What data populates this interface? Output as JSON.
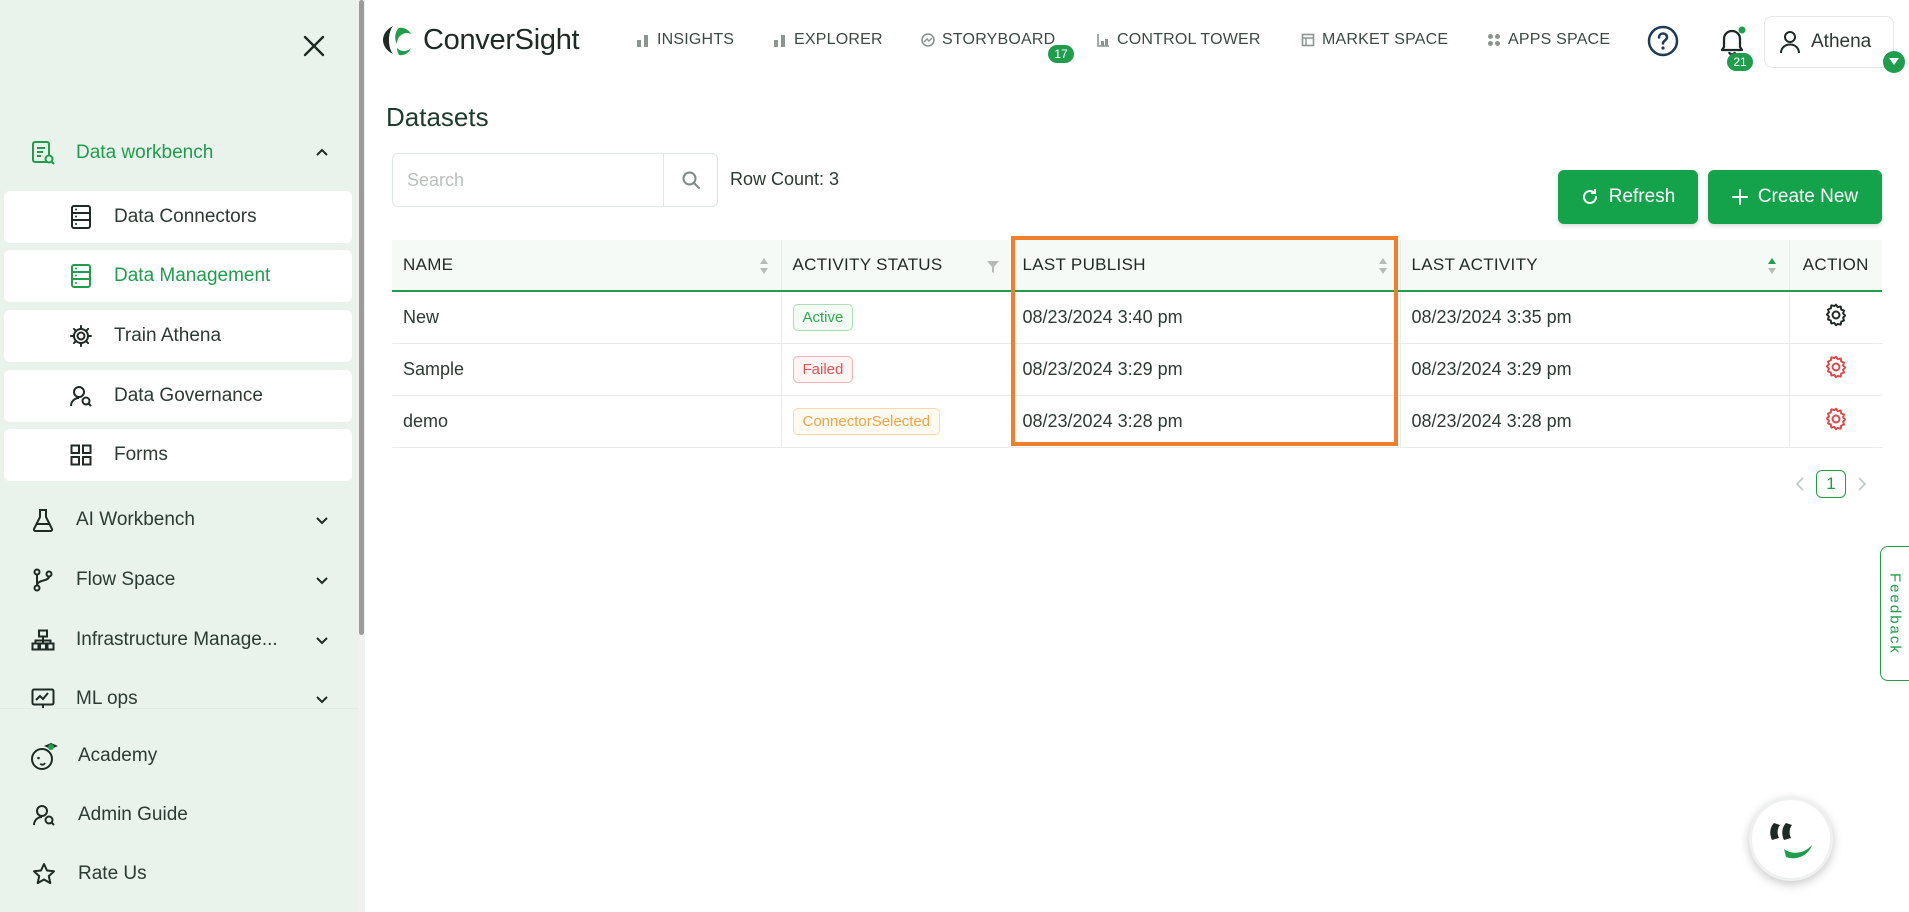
{
  "app": {
    "brand": "ConverSight",
    "accent": "#1f9d4c",
    "button_green": "#14a24a",
    "highlight": "#f07e2b"
  },
  "sidebar": {
    "close_icon": "close-icon",
    "groups": [
      {
        "label": "Data workbench",
        "icon": "data-workbench-icon",
        "expanded": true
      },
      {
        "label": "AI Workbench",
        "icon": "flask-icon"
      },
      {
        "label": "Flow Space",
        "icon": "flow-branch-icon"
      },
      {
        "label": "Infrastructure Manage...",
        "icon": "hierarchy-icon"
      },
      {
        "label": "ML ops",
        "icon": "monitor-chart-icon"
      }
    ],
    "sub_items": [
      {
        "label": "Data Connectors",
        "icon": "server-icon"
      },
      {
        "label": "Data Management",
        "icon": "server-icon",
        "selected": true
      },
      {
        "label": "Train Athena",
        "icon": "gear-icon"
      },
      {
        "label": "Data Governance",
        "icon": "user-search-icon"
      },
      {
        "label": "Forms",
        "icon": "grid-icon"
      }
    ],
    "bottom": [
      {
        "label": "Academy",
        "icon": "academy-icon"
      },
      {
        "label": "Admin Guide",
        "icon": "admin-user-icon"
      },
      {
        "label": "Rate Us",
        "icon": "star-icon"
      }
    ]
  },
  "topnav": {
    "items": [
      {
        "label": "INSIGHTS",
        "icon": "bar-chart-icon"
      },
      {
        "label": "EXPLORER",
        "icon": "bar-chart-icon"
      },
      {
        "label": "STORYBOARD",
        "icon": "storyboard-icon",
        "badge": "17"
      },
      {
        "label": "CONTROL TOWER",
        "icon": "tower-icon"
      },
      {
        "label": "MARKET SPACE",
        "icon": "market-icon"
      },
      {
        "label": "APPS SPACE",
        "icon": "apps-icon"
      }
    ],
    "notifications_badge": "21",
    "user_name": "Athena"
  },
  "main": {
    "title": "Datasets",
    "search_placeholder": "Search",
    "row_count": "Row Count: 3",
    "refresh_label": "Refresh",
    "create_label": "Create New",
    "columns": [
      "NAME",
      "ACTIVITY STATUS",
      "LAST PUBLISH",
      "LAST ACTIVITY",
      "ACTION"
    ],
    "rows": [
      {
        "name": "New",
        "status": "Active",
        "status_type": "active",
        "last_publish": "08/23/2024 3:40 pm",
        "last_activity": "08/23/2024 3:35 pm",
        "action_color": "#1e2a24"
      },
      {
        "name": "Sample",
        "status": "Failed",
        "status_type": "failed",
        "last_publish": "08/23/2024 3:29 pm",
        "last_activity": "08/23/2024 3:29 pm",
        "action_color": "#e04848"
      },
      {
        "name": "demo",
        "status": "ConnectorSelected",
        "status_type": "connector",
        "last_publish": "08/23/2024 3:28 pm",
        "last_activity": "08/23/2024 3:28 pm",
        "action_color": "#e04848"
      }
    ],
    "pagination": {
      "current": "1"
    },
    "feedback_label": "Feedback"
  }
}
